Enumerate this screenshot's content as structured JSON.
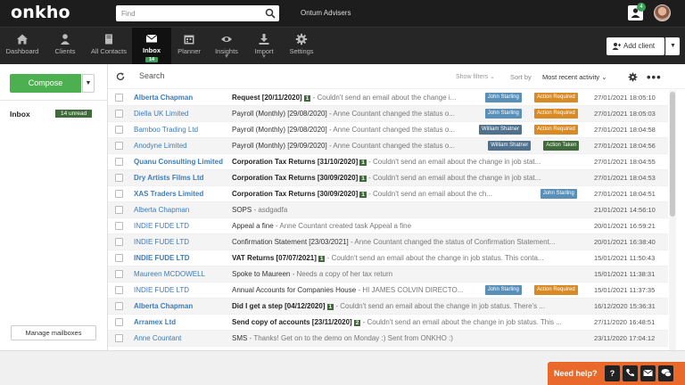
{
  "app": {
    "logo": "onkho",
    "org_name": "Ontum Advisers",
    "notifications": "4"
  },
  "search": {
    "placeholder": "Find"
  },
  "nav": [
    {
      "label": "Dashboard",
      "icon": "home-icon"
    },
    {
      "label": "Clients",
      "icon": "user-icon"
    },
    {
      "label": "All Contacts",
      "icon": "book-icon"
    },
    {
      "label": "Inbox",
      "icon": "envelope-icon",
      "count": "14",
      "active": true
    },
    {
      "label": "Planner",
      "icon": "calendar-icon"
    },
    {
      "label": "Insights",
      "icon": "eye-icon"
    },
    {
      "label": "Import",
      "icon": "download-icon"
    },
    {
      "label": "Settings",
      "icon": "gear-icon"
    }
  ],
  "header": {
    "add_client": "Add client"
  },
  "sidebar": {
    "compose": "Compose",
    "mailbox": "Inbox",
    "unread": "14 unread",
    "manage": "Manage mailboxes"
  },
  "toolbar": {
    "search_label": "Search",
    "show_filters": "Show filters",
    "sort_label": "Sort by",
    "sort_value": "Most recent activity"
  },
  "tag_colors": {
    "blue": "#5a8fb8",
    "orange": "#d88a25",
    "dkblue": "#4f718d",
    "green": "#3f6b3a"
  },
  "messages": [
    {
      "client": "Alberta Chapman",
      "subject": "Request [20/11/2020]",
      "count": "1",
      "preview": "- Couldn't send an email about the change i...",
      "tags": [
        {
          "label": "John Starling",
          "color": "blue"
        },
        {
          "label": "Action Required",
          "color": "orange"
        }
      ],
      "date": "27/01/2021 18:05:10",
      "unread": true
    },
    {
      "client": "Diella UK Limited",
      "subject": "Payroll (Monthly) [29/08/2020]",
      "preview": "- Anne Countant changed the status o...",
      "tags": [
        {
          "label": "John Starling",
          "color": "blue"
        },
        {
          "label": "Action Required",
          "color": "orange"
        }
      ],
      "date": "27/01/2021 18:05:03",
      "unread": false
    },
    {
      "client": "Bamboo Trading Ltd",
      "subject": "Payroll (Monthly) [29/08/2020]",
      "preview": "- Anne Countant changed the status o...",
      "tags": [
        {
          "label": "William Shatner",
          "color": "dkblue"
        },
        {
          "label": "Action Required",
          "color": "orange"
        }
      ],
      "date": "27/01/2021 18:04:58",
      "unread": false
    },
    {
      "client": "Anodyne Limited",
      "subject": "Payroll (Monthly) [29/09/2020]",
      "preview": "- Anne Countant changed the status o...",
      "tags": [
        {
          "label": "William Shatner",
          "color": "dkblue"
        },
        {
          "label": "Action Taken",
          "color": "green"
        }
      ],
      "date": "27/01/2021 18:04:56",
      "unread": false
    },
    {
      "client": "Quanu Consulting Limited",
      "subject": "Corporation Tax Returns [31/10/2020]",
      "count": "1",
      "preview": "- Couldn't send an email about the change in job stat...",
      "tags": [],
      "date": "27/01/2021 18:04:55",
      "unread": true
    },
    {
      "client": "Dry Artists Films Ltd",
      "subject": "Corporation Tax Returns [30/09/2020]",
      "count": "1",
      "preview": "- Couldn't send an email about the change in job stat...",
      "tags": [],
      "date": "27/01/2021 18:04:53",
      "unread": true
    },
    {
      "client": "XAS Traders Limited",
      "subject": "Corporation Tax Returns [30/09/2020]",
      "count": "1",
      "preview": "- Couldn't send an email about the ch...",
      "tags": [
        {
          "label": "John Starling",
          "color": "blue"
        }
      ],
      "date": "27/01/2021 18:04:51",
      "unread": true
    },
    {
      "client": "Alberta Chapman",
      "subject": "SOPS",
      "preview": "- asdgadfa",
      "tags": [],
      "date": "21/01/2021 14:56:10",
      "unread": false
    },
    {
      "client": "INDIE FUDE LTD",
      "subject": "Appeal a fine",
      "preview": "- Anne Countant created task Appeal a fine",
      "tags": [],
      "date": "20/01/2021 16:59:21",
      "unread": false
    },
    {
      "client": "INDIE FUDE LTD",
      "subject": "Confirmation Statement [23/03/2021]",
      "preview": "- Anne Countant changed the status of Confirmation Statement...",
      "tags": [],
      "date": "20/01/2021 16:38:40",
      "unread": false
    },
    {
      "client": "INDIE FUDE LTD",
      "subject": "VAT Returns [07/07/2021]",
      "count": "1",
      "preview": "- Couldn't send an email about the change in job status. This conta...",
      "tags": [],
      "date": "15/01/2021 11:50:43",
      "unread": true
    },
    {
      "client": "Maureen MCDOWELL",
      "subject": "Spoke to Maureen",
      "preview": "- Needs a copy of her tax return",
      "tags": [],
      "date": "15/01/2021 11:38:31",
      "unread": false
    },
    {
      "client": "INDIE FUDE LTD",
      "subject": "Annual Accounts for Companies House",
      "preview": "- HI JAMES COLVIN  DIRECTO...",
      "tags": [
        {
          "label": "John Starling",
          "color": "blue"
        },
        {
          "label": "Action Required",
          "color": "orange"
        }
      ],
      "date": "15/01/2021 11:37:35",
      "unread": false
    },
    {
      "client": "Alberta Chapman",
      "subject": "Did I get a step [04/12/2020]",
      "count": "1",
      "preview": "- Couldn't send an email about the change in job status. There's ...",
      "tags": [],
      "date": "16/12/2020 15:36:31",
      "unread": true
    },
    {
      "client": "Arramex Ltd",
      "subject": "Send copy of accounts [23/11/2020]",
      "count": "2",
      "preview": "- Couldn't send an email about the change in job status. This ...",
      "tags": [],
      "date": "27/11/2020 16:48:51",
      "unread": true
    },
    {
      "client": "Anne Countant",
      "subject": "SMS",
      "preview": "- Thanks! Get on to the demo on Monday :) Sent from ONKHO :)",
      "tags": [],
      "date": "23/11/2020 17:04:12",
      "unread": false
    }
  ],
  "help": {
    "label": "Need help?",
    "buttons": [
      "?",
      "phone-icon",
      "mail-icon",
      "chat-icon"
    ]
  }
}
